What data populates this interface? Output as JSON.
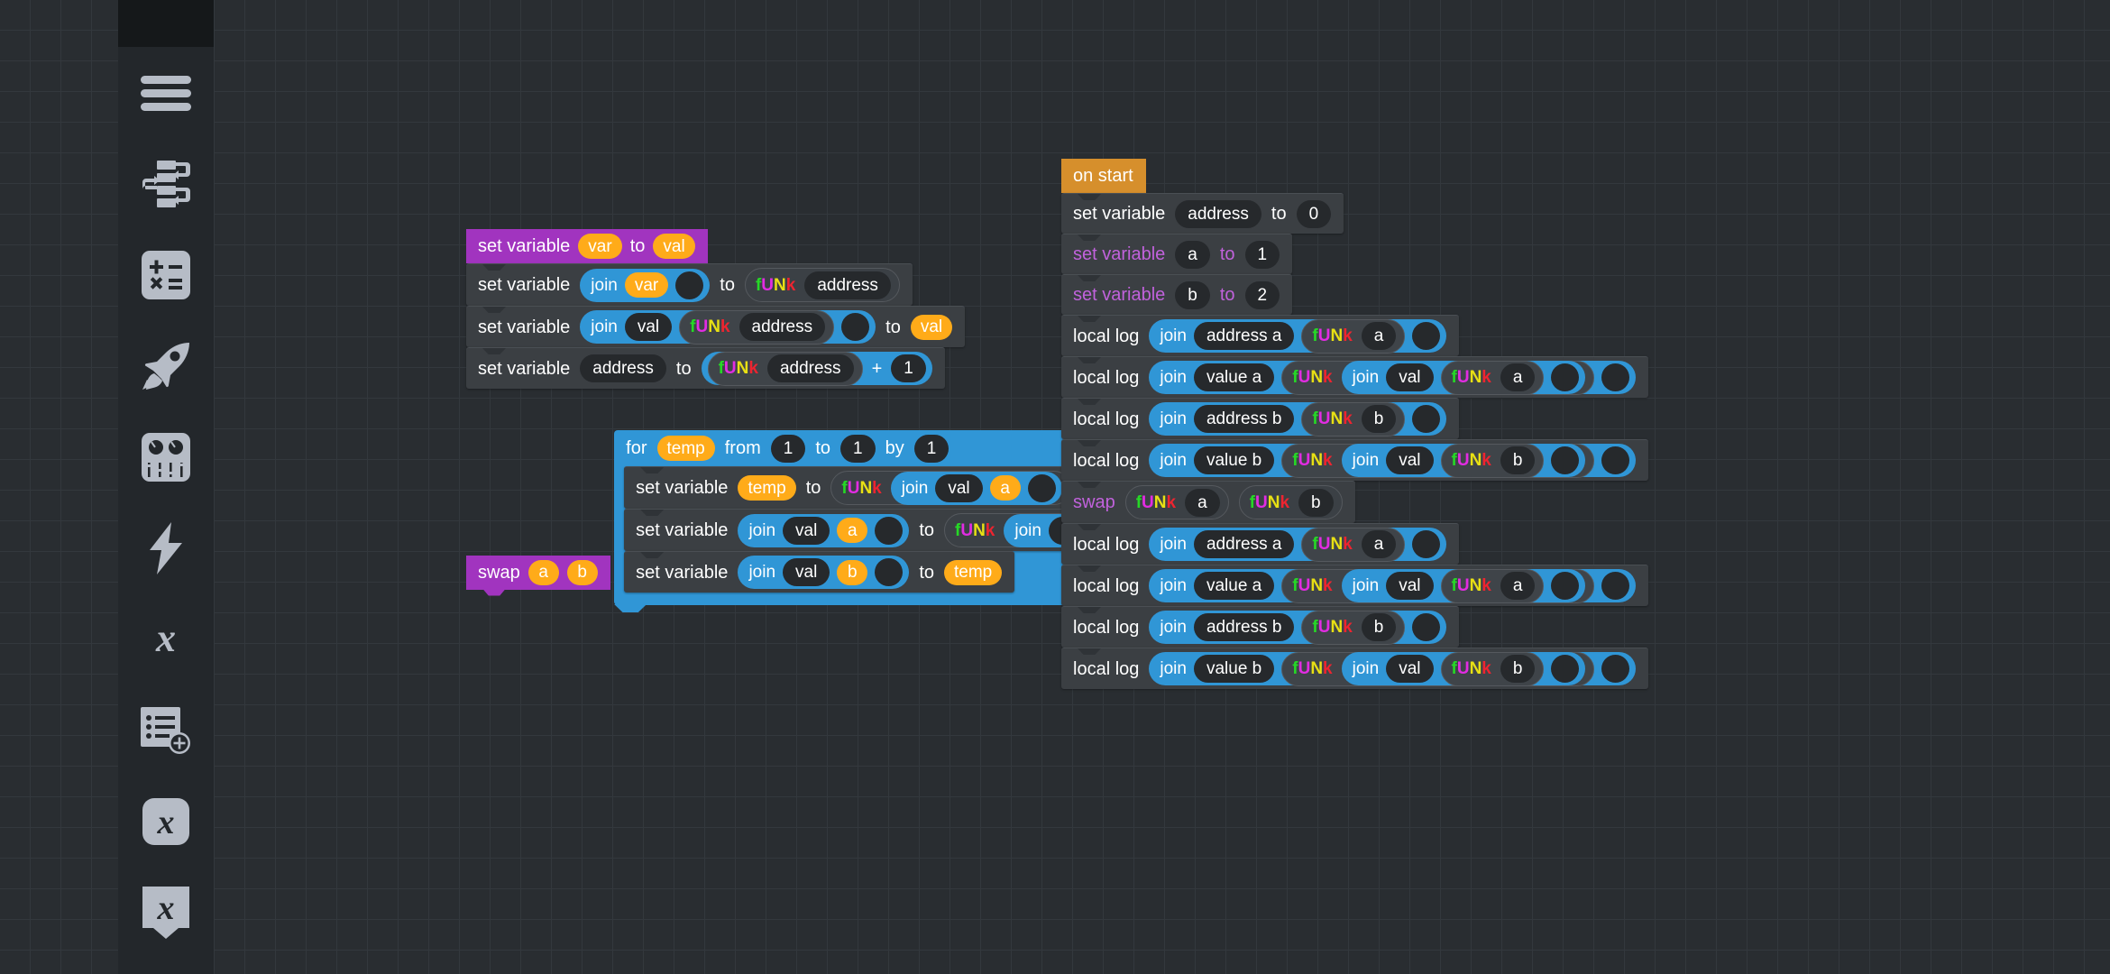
{
  "app": {
    "theme": "dark-blockly-editor",
    "canvas_bg": "#292d31",
    "grid_line": "#33383d",
    "grid_size_px": 34
  },
  "colors": {
    "definition_purple": "#a134bf",
    "event_orange": "#d68f2c",
    "reporter_blue": "#3096d6",
    "variable_pill_orange": "#ffab19",
    "statement_row": "#3b3f43",
    "field_dark": "#26292c",
    "magenta_label": "#c162dc",
    "funk_f": "#26d826",
    "funk_u": "#e22ce2",
    "funk_n": "#e8e014",
    "funk_k": "#ee2430"
  },
  "toolbar": {
    "items": [
      {
        "name": "menu-icon",
        "label": "Menu"
      },
      {
        "name": "flow-blocks-icon",
        "label": "Blocks / Flow"
      },
      {
        "name": "calculator-icon",
        "label": "Math"
      },
      {
        "name": "rocket-icon",
        "label": "Run / Deploy"
      },
      {
        "name": "mixer-icon",
        "label": "Controls"
      },
      {
        "name": "lightning-icon",
        "label": "Events"
      },
      {
        "name": "variable-x-icon",
        "label": "Variable"
      },
      {
        "name": "list-add-icon",
        "label": "Add List"
      },
      {
        "name": "variable-x-rounded-icon",
        "label": "Variable Block"
      },
      {
        "name": "variable-x-tagged-icon",
        "label": "Variable Tag"
      }
    ]
  },
  "labels": {
    "set_variable": "set variable",
    "to": "to",
    "join": "join",
    "for": "for",
    "from": "from",
    "by": "by",
    "local_log": "local log",
    "swap": "swap",
    "on_start": "on start",
    "plus": "+",
    "funk": {
      "f": "f",
      "u": "U",
      "n": "N",
      "k": "k"
    }
  },
  "variables": {
    "var": "var",
    "val": "val",
    "address": "address",
    "a": "a",
    "b": "b",
    "temp": "temp",
    "address_a": "address a",
    "address_b": "address b",
    "value_a": "value a",
    "value_b": "value b"
  },
  "numbers": {
    "zero": "0",
    "one": "1",
    "two": "2"
  },
  "stacks": [
    {
      "name": "set-variable-definition",
      "hat": {
        "kind": "purple",
        "label": "set variable",
        "params": [
          "var",
          "val"
        ]
      },
      "rows": [
        "set variable (join var ▢) to fUNk(address)",
        "set variable (join val fUNk(address) ▢) to val",
        "set variable (address) to fUNk(address) + 1"
      ]
    },
    {
      "name": "swap-definition",
      "hat": {
        "kind": "purple",
        "label": "swap",
        "params": [
          "a",
          "b"
        ]
      },
      "loop": {
        "label": "for",
        "var": "temp",
        "from": "1",
        "to": "1",
        "by": "1"
      },
      "rows": [
        "set variable temp to fUNk(join val a ▢)",
        "set variable (join val a ▢) to fUNk(join val b ▢)",
        "set variable (join val b ▢) to temp"
      ]
    },
    {
      "name": "on-start-event",
      "hat": {
        "kind": "orange",
        "label": "on start",
        "params": []
      },
      "rows": [
        "set variable (address) to 0",
        "set variable (a) to 1",
        "set variable (b) to 2",
        "local log (join 'address a' fUNk(a) ▢)",
        "local log (join 'value a' fUNk(join val fUNk(a) ▢) ▢)",
        "local log (join 'address b' fUNk(b) ▢)",
        "local log (join 'value b' fUNk(join val fUNk(b) ▢) ▢)",
        "swap fUNk(a) fUNk(b)",
        "local log (join 'address a' fUNk(a) ▢)",
        "local log (join 'value a' fUNk(join val fUNk(a) ▢) ▢)",
        "local log (join 'address b' fUNk(b) ▢)",
        "local log (join 'value b' fUNk(join val fUNk(b) ▢) ▢)"
      ]
    }
  ]
}
